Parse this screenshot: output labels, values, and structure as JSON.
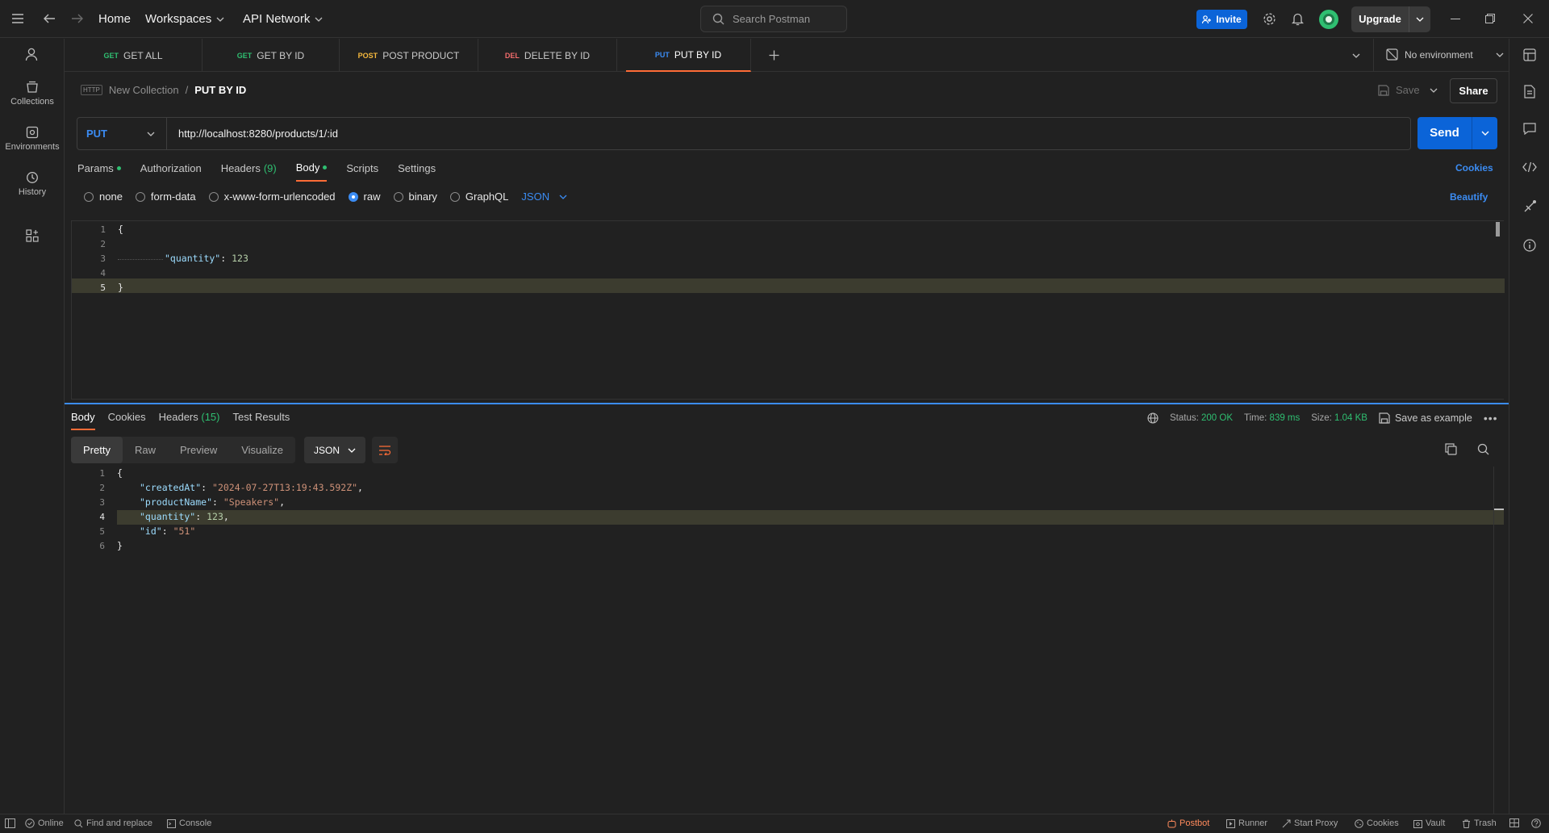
{
  "titlebar": {
    "home": "Home",
    "workspaces": "Workspaces",
    "api_network": "API Network",
    "search_placeholder": "Search Postman",
    "invite": "Invite",
    "upgrade": "Upgrade"
  },
  "sidebar": {
    "items": [
      {
        "label": "Collections",
        "icon": "collections-icon"
      },
      {
        "label": "Environments",
        "icon": "environments-icon"
      },
      {
        "label": "History",
        "icon": "history-icon"
      }
    ]
  },
  "tabs": [
    {
      "method": "GET",
      "label": "GET ALL",
      "color": "#2fbf71"
    },
    {
      "method": "GET",
      "label": "GET BY ID",
      "color": "#2fbf71"
    },
    {
      "method": "POST",
      "label": "POST PRODUCT",
      "color": "#f5b83d"
    },
    {
      "method": "DEL",
      "label": "DELETE BY ID",
      "color": "#f06b6b"
    },
    {
      "method": "PUT",
      "label": "PUT BY ID",
      "color": "#3b8cf3",
      "active": true
    }
  ],
  "environment": "No environment",
  "breadcrumb": {
    "collection": "New Collection",
    "separator": "/",
    "request": "PUT BY ID"
  },
  "actions": {
    "save": "Save",
    "share": "Share"
  },
  "request": {
    "method": "PUT",
    "url": "http://localhost:8280/products/1/:id",
    "send": "Send"
  },
  "request_tabs": {
    "params": "Params",
    "authorization": "Authorization",
    "headers": "Headers",
    "headers_count": "(9)",
    "body": "Body",
    "scripts": "Scripts",
    "settings": "Settings",
    "cookies": "Cookies"
  },
  "body_types": {
    "none": "none",
    "form_data": "form-data",
    "urlencoded": "x-www-form-urlencoded",
    "raw": "raw",
    "binary": "binary",
    "graphql": "GraphQL",
    "format": "JSON",
    "beautify": "Beautify"
  },
  "request_body": {
    "line_numbers": [
      "1",
      "2",
      "3",
      "4",
      "5"
    ],
    "open": "{",
    "key": "\"quantity\"",
    "colon": ": ",
    "value": "123",
    "close": "}"
  },
  "response_tabs": {
    "body": "Body",
    "cookies": "Cookies",
    "headers": "Headers",
    "headers_count": "(15)",
    "test_results": "Test Results"
  },
  "response_status": {
    "status_label": "Status:",
    "status_value": "200 OK",
    "time_label": "Time:",
    "time_value": "839 ms",
    "size_label": "Size:",
    "size_value": "1.04 KB",
    "save_example": "Save as example"
  },
  "response_view": {
    "pretty": "Pretty",
    "raw": "Raw",
    "preview": "Preview",
    "visualize": "Visualize",
    "format": "JSON"
  },
  "response_body": {
    "line_numbers": [
      "1",
      "2",
      "3",
      "4",
      "5",
      "6"
    ],
    "open": "{",
    "created_key": "\"createdAt\"",
    "created_val": "\"2024-07-27T13:19:43.592Z\"",
    "product_key": "\"productName\"",
    "product_val": "\"Speakers\"",
    "quantity_key": "\"quantity\"",
    "quantity_val": "123",
    "id_key": "\"id\"",
    "id_val": "\"51\"",
    "close": "}"
  },
  "statusbar": {
    "online": "Online",
    "find_replace": "Find and replace",
    "console": "Console",
    "postbot": "Postbot",
    "runner": "Runner",
    "start_proxy": "Start Proxy",
    "cookies": "Cookies",
    "vault": "Vault",
    "trash": "Trash"
  }
}
